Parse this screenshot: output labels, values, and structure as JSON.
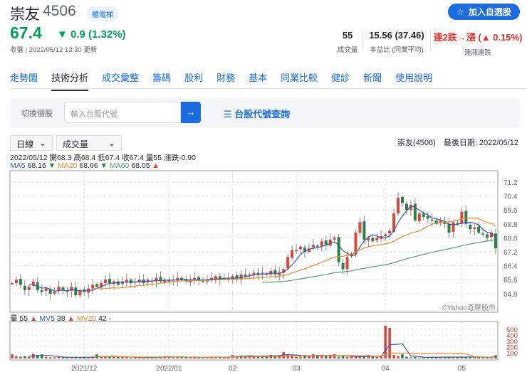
{
  "header": {
    "name": "崇友",
    "code": "4506",
    "tag": "櫃電梯",
    "price": "67.4",
    "change": "0.9 (1.32%)",
    "updated": "收盤 | 2022/05/12 13:30 更新",
    "watch_label": "加入自選股"
  },
  "stats": [
    {
      "value": "55",
      "label": "成交量"
    },
    {
      "value": "15.56 (37.46)",
      "label": "本益比 (同業平均)"
    },
    {
      "value": "連2跌→漲 (▲ 0.15%)",
      "label": "連漲連跌"
    }
  ],
  "tabs": [
    "走勢圖",
    "技術分析",
    "成交彙整",
    "籌碼",
    "股利",
    "財務",
    "基本",
    "同業比較",
    "健診",
    "新聞",
    "使用說明"
  ],
  "search": {
    "label": "切換個股",
    "placeholder": "輸入台股代號",
    "lookup": "台股代號查詢"
  },
  "controls": {
    "period": "日線",
    "indicator": "成交量"
  },
  "info": {
    "right": "崇友(4506)　最後日期: 2022/05/12",
    "ohlc": "2022/05/12 開68.3 高68.4 低67.4 收67.4 量55 漲跌-0.90",
    "ma5": "MA5",
    "ma5v": "68.16",
    "ma20": "MA20",
    "ma20v": "68.66",
    "ma60": "MA60",
    "ma60v": "68.05",
    "vol": "量",
    "volv": "55",
    "mv5": "MV5",
    "mv5v": "38",
    "mv20": "MV20",
    "mv20v": "42 -",
    "watermark": "©Yahoo奇摩股市"
  },
  "colors": {
    "up": "#d9473f",
    "down": "#2e7d4a",
    "ma5": "#3a5ba8",
    "ma20": "#e88a2e",
    "ma60": "#5a9a72",
    "accent": "#1a6ce0"
  },
  "chart_data": {
    "type": "candlestick",
    "price_ticks": [
      71.2,
      70.4,
      69.6,
      68.8,
      68.0,
      67.2,
      66.4,
      65.6,
      64.8
    ],
    "price_range": [
      64.2,
      71.9
    ],
    "vol_ticks": [
      500,
      400,
      300,
      200,
      100
    ],
    "vol_range": [
      0,
      600
    ],
    "date_labels": [
      {
        "label": "2021/12",
        "index": 17
      },
      {
        "label": "2022/01",
        "index": 37
      },
      {
        "label": "02",
        "index": 52
      },
      {
        "label": "03",
        "index": 67
      },
      {
        "label": "04",
        "index": 88
      },
      {
        "label": "05",
        "index": 106
      }
    ],
    "close": [
      65.4,
      65.6,
      65.3,
      65.0,
      65.2,
      65.5,
      65.0,
      64.9,
      65.1,
      64.8,
      64.9,
      65.2,
      65.0,
      64.9,
      65.2,
      64.7,
      65.0,
      64.9,
      65.1,
      65.3,
      65.2,
      65.4,
      65.6,
      65.4,
      65.5,
      65.3,
      65.5,
      65.6,
      65.4,
      65.5,
      65.6,
      65.4,
      65.6,
      65.5,
      65.7,
      65.5,
      65.6,
      65.5,
      65.6,
      65.7,
      65.6,
      65.5,
      65.6,
      65.7,
      65.6,
      65.5,
      65.6,
      65.7,
      65.8,
      65.6,
      65.7,
      65.6,
      65.8,
      65.7,
      65.9,
      65.8,
      65.9,
      66.0,
      65.9,
      66.0,
      65.9,
      66.1,
      65.9,
      66.0,
      66.2,
      66.9,
      67.3,
      67.3,
      67.5,
      67.2,
      67.4,
      67.6,
      67.5,
      67.8,
      67.6,
      67.9,
      68.0,
      66.6,
      66.2,
      66.9,
      67.1,
      68.3,
      68.9,
      67.9,
      68.0,
      67.8,
      68.0,
      68.1,
      68.2,
      68.4,
      69.4,
      70.3,
      70.0,
      69.6,
      69.9,
      69.0,
      69.4,
      69.2,
      69.1,
      69.0,
      68.8,
      69.0,
      68.8,
      68.3,
      68.9,
      68.8,
      69.5,
      68.8,
      68.5,
      68.6,
      68.3,
      68.2,
      68.0,
      68.3,
      67.4
    ],
    "volume": [
      70,
      40,
      30,
      40,
      30,
      80,
      60,
      70,
      30,
      20,
      20,
      30,
      20,
      20,
      20,
      20,
      20,
      25,
      20,
      20,
      70,
      25,
      30,
      30,
      35,
      30,
      25,
      20,
      15,
      20,
      20,
      15,
      20,
      25,
      20,
      30,
      40,
      25,
      20,
      25,
      30,
      20,
      20,
      25,
      20,
      25,
      20,
      30,
      25,
      20,
      20,
      25,
      60,
      40,
      50,
      30,
      45,
      40,
      35,
      50,
      40,
      60,
      45,
      55,
      110,
      60,
      40,
      25,
      30,
      60,
      40,
      70,
      60,
      50,
      40,
      55,
      70,
      30,
      40,
      25,
      30,
      30,
      40,
      30,
      60,
      30,
      25,
      30,
      560,
      520,
      60,
      40,
      70,
      30,
      20,
      25,
      15,
      20,
      20,
      30,
      20,
      25,
      20,
      30,
      25,
      20,
      25,
      30,
      25,
      20,
      20,
      25,
      20,
      30,
      55
    ]
  }
}
